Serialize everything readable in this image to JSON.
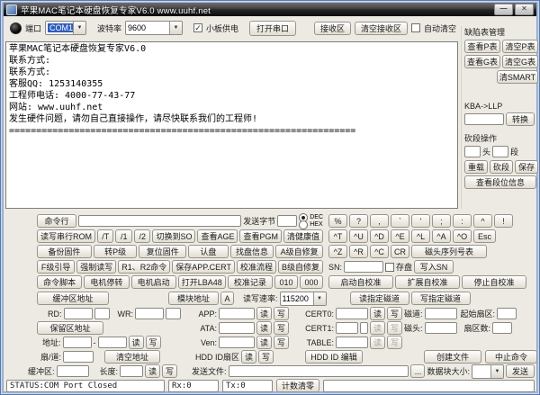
{
  "colors": {
    "selection_blue": "#2e5dbc",
    "titlebar_dark": "#242424",
    "frame_blue": "#8ea9cf"
  },
  "titlebar": {
    "title": "苹果MAC笔记本硬盘恢复专家V6.0 www.uuhf.net",
    "minimize_glyph": "—",
    "close_glyph": "✕"
  },
  "toolbar": {
    "port_label": "端口",
    "port_value": "COM1",
    "baud_label": "波特率",
    "baud_value": "9600",
    "board_power_label": "小板供电",
    "check_glyph": "✓",
    "open_port_button": "打开串口",
    "receive_area_button": "接收区",
    "clear_receive_button": "清空接收区",
    "auto_clear_label": "自动清空"
  },
  "terminal": {
    "text": "苹果MAC笔记本硬盘恢复专家V6.0\n联系方式:\n联系方式:\n客服QQ: 1253140355\n工程师电话: 4000-77-43-77\n网站: www.uuhf.net\n发生硬件问题，请勿自己直接操作，请尽快联系我们的工程师!\n================================================================"
  },
  "defect_panel": {
    "title": "缺陷表管理",
    "view_p": "查看P表",
    "clear_p": "清空P表",
    "view_g": "查看G表",
    "clear_g": "清空G表",
    "clear_smart": "清SMART",
    "kba_label": "KBA->LLP",
    "convert_button": "转换",
    "cut_section_label": "砍段操作",
    "head_suffix": "头",
    "segment_suffix": "段",
    "reload_button": "重载",
    "cut_button": "砍段",
    "save_button": "保存",
    "view_segment_button": "查看段位信息"
  },
  "command_row": {
    "cmd_button": "命令行",
    "send_bytes_label": "发送字节",
    "dec_label": "DEC",
    "hex_label": "HEX"
  },
  "grid": {
    "r1": [
      "读写串行ROM",
      "/T",
      "/1",
      "/2",
      "切换到SO",
      "查看AGE",
      "查看PGM",
      "清健康值"
    ],
    "r2": [
      "备份固件",
      "转P级",
      "复位固件",
      "认盘",
      "找盘信息",
      "A级自修复"
    ],
    "r3": [
      "F级引导",
      "强制读写",
      "R1、R2命令",
      "保存APP.CERT",
      "校准流程",
      "B级自修复"
    ],
    "r4": [
      "命令脚本",
      "电机停转",
      "电机启动",
      "打开LBA48",
      "校准记录",
      "010",
      "000"
    ]
  },
  "keypad": {
    "r1": [
      "%",
      "?",
      ",",
      "`",
      "'",
      ";",
      ":",
      "^",
      "!"
    ],
    "r2": [
      "^T",
      "^U",
      "^D",
      "^E",
      "^L",
      "^A",
      "^O",
      "Esc"
    ],
    "r3": [
      "^Z",
      "^R",
      "^C",
      "CR",
      "磁头序列号表"
    ]
  },
  "sn_row": {
    "label": "SN:",
    "save_label": "存盘",
    "write_button": "写入SN"
  },
  "calibration": {
    "start": "启动自校准",
    "extend": "扩展自校准",
    "stop": "停止自校准"
  },
  "address_row": {
    "buffer_addr_button": "缓冲区地址",
    "module_addr_button": "模块地址",
    "a_button": "A",
    "rate_label": "读写速率:",
    "rate_value": "115200",
    "read_track_button": "读指定磁道",
    "write_track_button": "写指定磁道"
  },
  "io_panel": {
    "rd_label": "RD:",
    "wr_label": "WR:",
    "reserved_button": "保留区地址",
    "addr_label": "地址:",
    "dash": "-",
    "sector_track_label": "扇/道:",
    "clear_addr_button": "清空地址",
    "read": "读",
    "write": "写",
    "app_label": "APP:",
    "ata_label": "ATA:",
    "ven_label": "Ven:",
    "hdd_id_label": "HDD ID扇区",
    "cert0_label": "CERT0:",
    "cert1_label": "CERT1:",
    "table_label": "TABLE:",
    "hdd_edit_button": "HDD ID 编辑",
    "track_label": "磁道:",
    "head_label": "磁头:",
    "start_sector_label": "起始扇区:",
    "sector_count_label": "扇区数:",
    "create_file_button": "创建文件",
    "abort_button": "中止命令"
  },
  "bottom_row": {
    "buffer_label": "缓冲区:",
    "length_label": "长度:",
    "read": "读",
    "write": "写",
    "send_file_label": "发送文件:",
    "browse_button": "...",
    "block_size_label": "数据块大小:",
    "send_button": "发送"
  },
  "statusbar": {
    "status": "STATUS:COM Port Closed",
    "rx": "Rx:0",
    "tx": "Tx:0",
    "clear_count_button": "计数清零"
  }
}
